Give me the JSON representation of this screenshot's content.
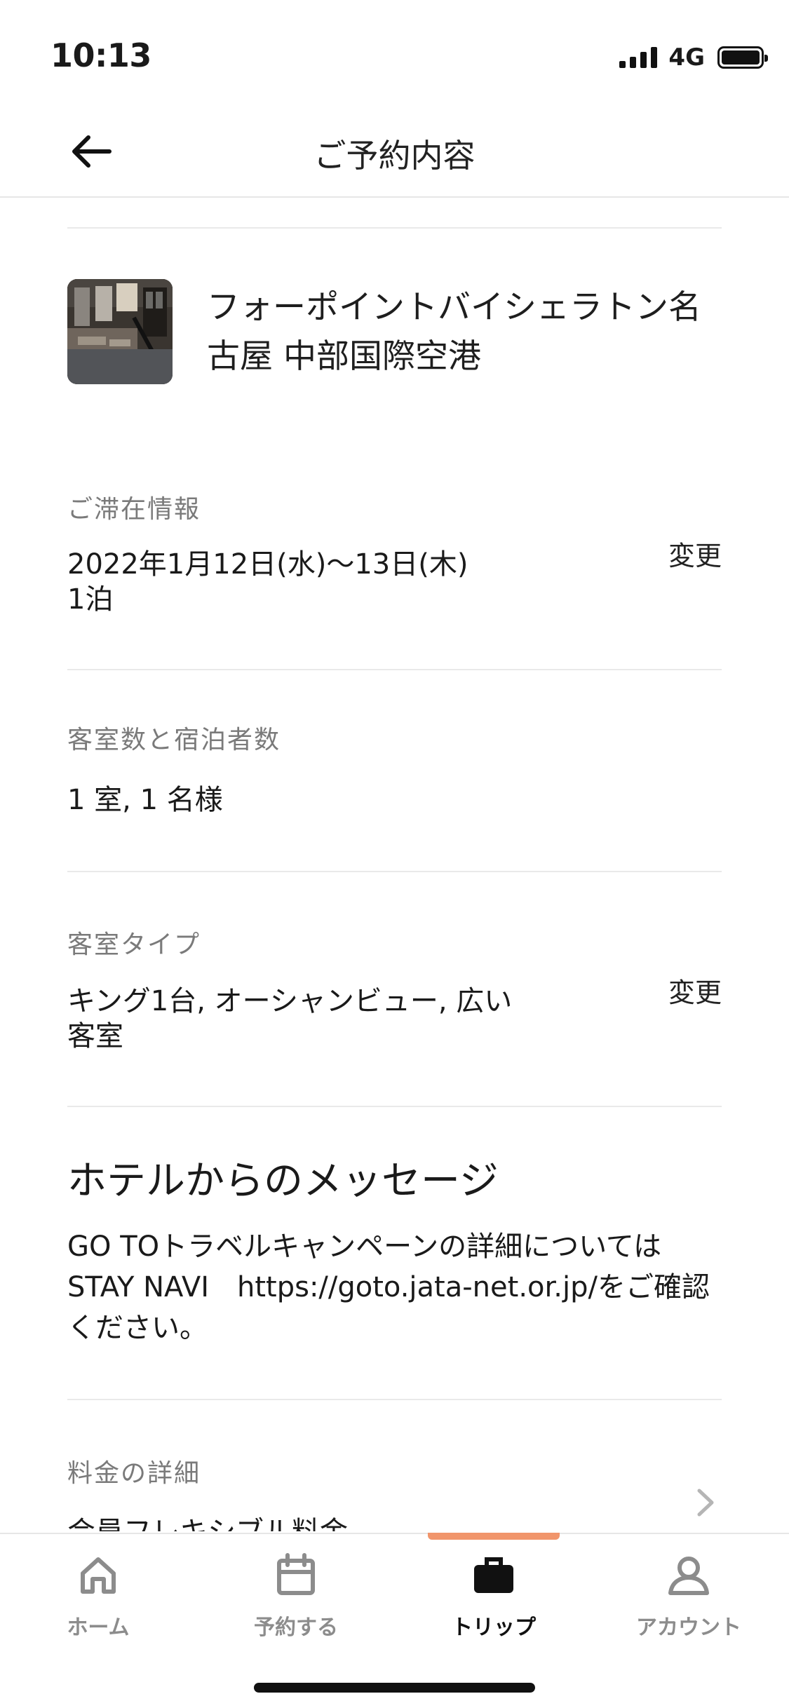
{
  "status_bar": {
    "time": "10:13",
    "network": "4G"
  },
  "header": {
    "title": "ご予約内容",
    "back_icon": "arrow-left-icon"
  },
  "hotel": {
    "name": "フォーポイントバイシェラトン名古屋 中部国際空港",
    "name_line1": "フォーポイントバイシェラトン名",
    "name_line2": "古屋 中部国際空港"
  },
  "stay": {
    "label": "ご滞在情報",
    "dates": "2022年1月12日(水)〜13日(木)",
    "nights": "1泊",
    "change": "変更"
  },
  "rooms_guests": {
    "label": "客室数と宿泊者数",
    "value": "1 室, 1 名様"
  },
  "room_type": {
    "label": "客室タイプ",
    "value_line1": "キング1台, オーシャンビュー, 広い",
    "value_line2": "客室",
    "change": "変更"
  },
  "hotel_message": {
    "heading": "ホテルからのメッセージ",
    "line1": "GO TOトラベルキャンペーンの詳細については",
    "line2": "STAY NAVI　https://goto.jata-net.or.jp/をご確認",
    "line3": "ください。"
  },
  "price_details": {
    "label": "料金の詳細",
    "rate_name": "会員フレキシブル料金",
    "chevron_icon": "chevron-right-icon"
  },
  "tab_bar": {
    "tabs": [
      {
        "label": "ホーム",
        "icon": "home-icon",
        "active": false
      },
      {
        "label": "予約する",
        "icon": "calendar-icon",
        "active": false
      },
      {
        "label": "トリップ",
        "icon": "briefcase-icon",
        "active": true
      },
      {
        "label": "アカウント",
        "icon": "person-icon",
        "active": false
      }
    ],
    "accent_color": "#f1956b"
  }
}
